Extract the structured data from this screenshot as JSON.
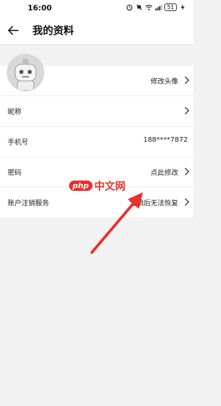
{
  "status_bar": {
    "time": "16:00",
    "battery": "51"
  },
  "header": {
    "title": "我的资料"
  },
  "rows": {
    "avatar": {
      "value": "修改头像"
    },
    "nickname": {
      "label": "昵称"
    },
    "phone": {
      "label": "手机号",
      "value": "188****7872"
    },
    "password": {
      "label": "密码",
      "value": "点此修改"
    },
    "deregister": {
      "label": "账户注销服务",
      "value": "注销后无法恢复"
    }
  },
  "watermark": {
    "badge": "php",
    "text": "中文网"
  },
  "colors": {
    "annotation": "#e8312a",
    "background": "#f2f2f2"
  }
}
